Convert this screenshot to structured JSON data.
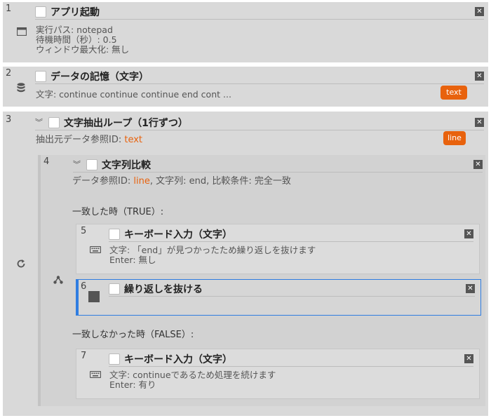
{
  "steps": {
    "s1": {
      "num": "1",
      "title": "アプリ起動",
      "lines": [
        "実行パス: notepad",
        "待機時間（秒）: 0.5",
        "ウィンドウ最大化: 無し"
      ]
    },
    "s2": {
      "num": "2",
      "title": "データの記憶（文字）",
      "detail": "文字: continue continue continue end cont ...",
      "badge": "text"
    },
    "s3": {
      "num": "3",
      "title": "文字抽出ループ（1行ずつ）",
      "detail_prefix": "抽出元データ参照ID: ",
      "detail_ref": "text",
      "badge": "line"
    },
    "s4": {
      "num": "4",
      "title": "文字列比較",
      "detail_prefix": "データ参照ID: ",
      "detail_ref": "line",
      "detail_suffix": ", 文字列: end, 比較条件: 完全一致",
      "true_label": "一致した時（TRUE）:",
      "false_label": "一致しなかった時（FALSE）:"
    },
    "s5": {
      "num": "5",
      "title": "キーボード入力（文字）",
      "lines": [
        "文字: 「end」が見つかったため繰り返しを抜けます",
        "Enter: 無し"
      ]
    },
    "s6": {
      "num": "6",
      "title": "繰り返しを抜ける"
    },
    "s7": {
      "num": "7",
      "title": "キーボード入力（文字）",
      "lines": [
        "文字: continueであるため処理を続けます",
        "Enter: 有り"
      ]
    }
  },
  "icons": {
    "close": "close-icon",
    "expand": "chevron-double-down-icon",
    "window": "window-icon",
    "database": "database-icon",
    "loop": "loop-icon",
    "branch": "branch-icon",
    "keyboard": "keyboard-icon",
    "stop": "stop-icon"
  },
  "colors": {
    "accent": "#e8620d",
    "selected_border": "#2f7de1",
    "panel": "#d9d9d9"
  }
}
